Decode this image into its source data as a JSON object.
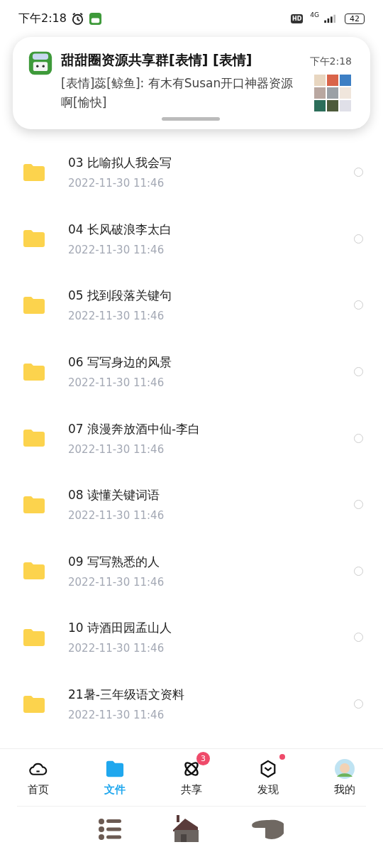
{
  "status_bar": {
    "time": "下午2:18",
    "network": "4G",
    "hd": "HD",
    "battery": "42"
  },
  "notification": {
    "title": "甜甜圈资源共享群[表情] [表情]",
    "time": "下午2:18",
    "message": "[表情]蕊[鲸鱼]: 有木有Susan开口神器资源啊[愉快]"
  },
  "files": [
    {
      "name": "03 比喻拟人我会写",
      "date": "2022-11-30  11:46",
      "selected": false
    },
    {
      "name": "04 长风破浪李太白",
      "date": "2022-11-30  11:46",
      "selected": false
    },
    {
      "name": "05 找到段落关键句",
      "date": "2022-11-30  11:46",
      "selected": false
    },
    {
      "name": "06 写写身边的风景",
      "date": "2022-11-30  11:46",
      "selected": false
    },
    {
      "name": "07 浪漫奔放酒中仙-李白",
      "date": "2022-11-30  11:46",
      "selected": false
    },
    {
      "name": "08 读懂关键词语",
      "date": "2022-11-30  11:46",
      "selected": false
    },
    {
      "name": "09 写写熟悉的人",
      "date": "2022-11-30  11:46",
      "selected": false
    },
    {
      "name": "10 诗酒田园孟山人",
      "date": "2022-11-30  11:46",
      "selected": false
    },
    {
      "name": "21暑-三年级语文资料",
      "date": "2022-11-30  11:46",
      "selected": false
    }
  ],
  "tabs": [
    {
      "label": "首页",
      "kind": "cloud",
      "selected": false
    },
    {
      "label": "文件",
      "kind": "folder",
      "selected": true
    },
    {
      "label": "共享",
      "kind": "atom",
      "selected": false,
      "badge": "3"
    },
    {
      "label": "发现",
      "kind": "cube",
      "selected": false,
      "dot": true
    },
    {
      "label": "我的",
      "kind": "avatar",
      "selected": false
    }
  ]
}
